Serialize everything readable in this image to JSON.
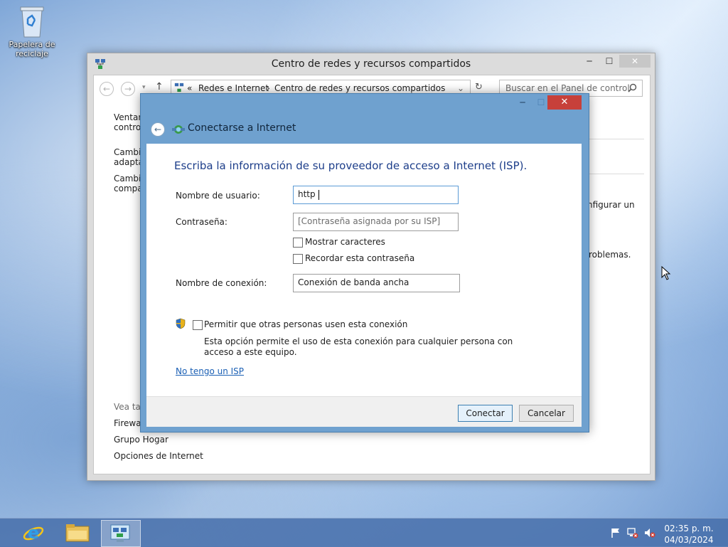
{
  "desktop": {
    "recycle_bin_label": "Papelera de reciclaje"
  },
  "main_window": {
    "title": "Centro de redes y recursos compartidos",
    "address": {
      "chevron": "«",
      "crumb1": "Redes e Internet",
      "separator": "›",
      "crumb2": "Centro de redes y recursos compartidos"
    },
    "search_placeholder": "Buscar en el Panel de control",
    "sidebar": {
      "item1_line1": "Ventana",
      "item1_line2": "control",
      "item2_line1": "Cambia",
      "item2_line2": "adaptad",
      "item3_line1": "Cambia",
      "item3_line2": "compar",
      "see_also": "Vea tam",
      "link_firewall": "Firewall",
      "link_homegroup": "Grupo Hogar",
      "link_internet_options": "Opciones de Internet"
    },
    "right_fragments": {
      "frag1": "nfigurar un",
      "frag2": "roblemas."
    },
    "caption_buttons": {
      "minimize": "─",
      "maximize": "☐",
      "close": "✕"
    }
  },
  "dialog": {
    "title": "Conectarse a Internet",
    "heading": "Escriba la información de su proveedor de acceso a Internet (ISP).",
    "username": {
      "label": "Nombre de usuario:",
      "value": "http"
    },
    "password": {
      "label": "Contraseña:",
      "placeholder": "[Contraseña asignada por su ISP]"
    },
    "show_chars_label": "Mostrar caracteres",
    "remember_password_label": "Recordar esta contraseña",
    "connection_name": {
      "label": "Nombre de conexión:",
      "value": "Conexión de banda ancha"
    },
    "allow_others_label": "Permitir que otras personas usen esta conexión",
    "allow_others_note": "Esta opción permite el uso de esta conexión para cualquier persona con acceso a este equipo.",
    "no_isp_link": "No tengo un ISP",
    "connect_button": "Conectar",
    "cancel_button": "Cancelar",
    "caption_buttons": {
      "minimize": "─",
      "maximize": "☐",
      "close": "✕"
    }
  },
  "taskbar": {
    "time": "02:35 p. m.",
    "date": "04/03/2024"
  }
}
